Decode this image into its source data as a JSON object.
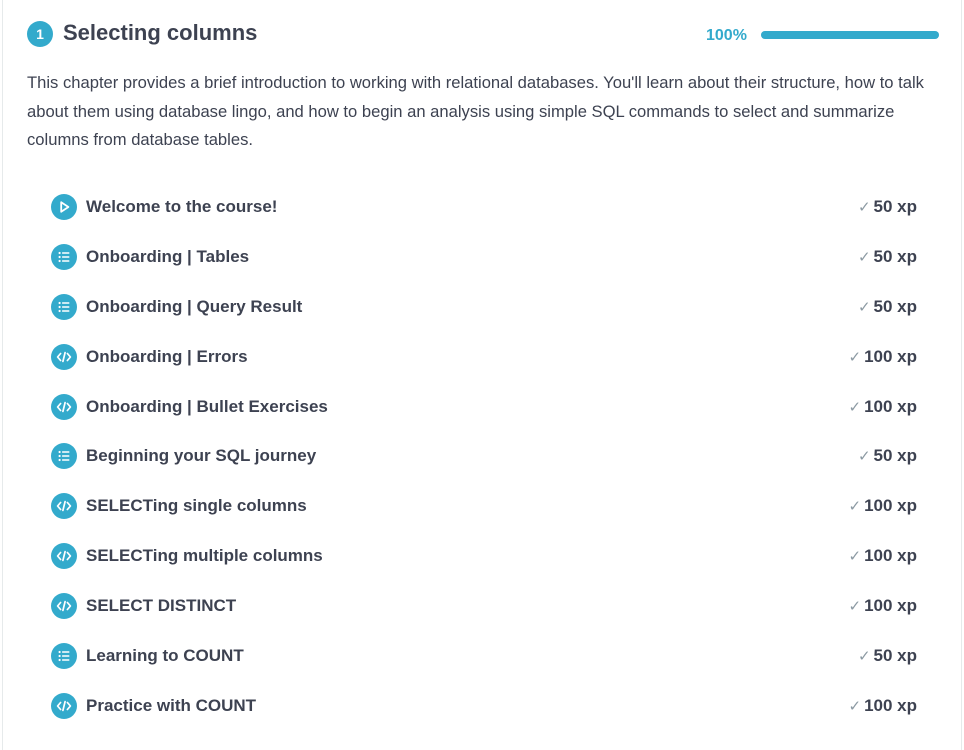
{
  "chapter": {
    "number": "1",
    "title": "Selecting columns",
    "progress_label": "100%",
    "progress_fraction": 1.0,
    "description": "This chapter provides a brief introduction to working with relational databases. You'll learn about their structure, how to talk about them using database lingo, and how to begin an analysis using simple SQL commands to select and summarize columns from database tables."
  },
  "colors": {
    "accent": "#33aacc",
    "text": "#3d4251",
    "check": "#8c9aa3"
  },
  "exercises": [
    {
      "title": "Welcome to the course!",
      "icon": "play-icon",
      "xp": "50 xp"
    },
    {
      "title": "Onboarding | Tables",
      "icon": "list-icon",
      "xp": "50 xp"
    },
    {
      "title": "Onboarding | Query Result",
      "icon": "list-icon",
      "xp": "50 xp"
    },
    {
      "title": "Onboarding | Errors",
      "icon": "code-icon",
      "xp": "100 xp"
    },
    {
      "title": "Onboarding | Bullet Exercises",
      "icon": "code-icon",
      "xp": "100 xp"
    },
    {
      "title": "Beginning your SQL journey",
      "icon": "list-icon",
      "xp": "50 xp"
    },
    {
      "title": "SELECTing single columns",
      "icon": "code-icon",
      "xp": "100 xp"
    },
    {
      "title": "SELECTing multiple columns",
      "icon": "code-icon",
      "xp": "100 xp"
    },
    {
      "title": "SELECT DISTINCT",
      "icon": "code-icon",
      "xp": "100 xp"
    },
    {
      "title": "Learning to COUNT",
      "icon": "list-icon",
      "xp": "50 xp"
    },
    {
      "title": "Practice with COUNT",
      "icon": "code-icon",
      "xp": "100 xp"
    }
  ]
}
